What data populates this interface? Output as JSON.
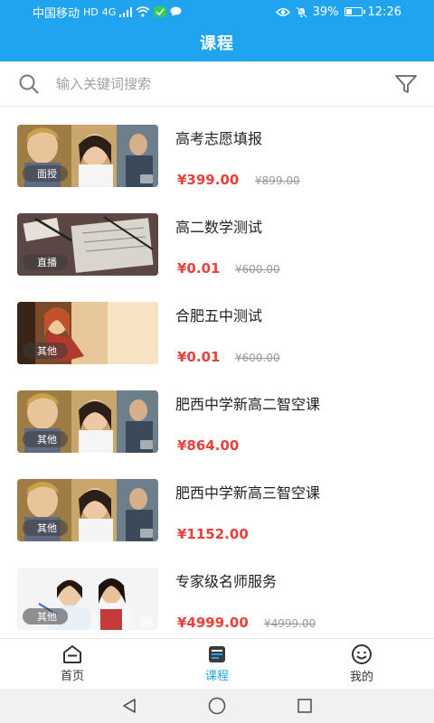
{
  "status_bar": {
    "carrier": "中国移动",
    "hd": "HD",
    "network": "4G",
    "battery": "39%",
    "battery_level": 0.39,
    "time": "12:26"
  },
  "header": {
    "title": "课程"
  },
  "search": {
    "placeholder": "输入关键词搜索"
  },
  "courses": [
    {
      "title": "高考志愿填报",
      "tag": "面授",
      "price": "¥399.00",
      "original_price": "¥899.00"
    },
    {
      "title": "高二数学测试",
      "tag": "直播",
      "price": "¥0.01",
      "original_price": "¥600.00"
    },
    {
      "title": "合肥五中测试",
      "tag": "其他",
      "price": "¥0.01",
      "original_price": "¥600.00"
    },
    {
      "title": "肥西中学新高二智空课",
      "tag": "其他",
      "price": "¥864.00",
      "original_price": ""
    },
    {
      "title": "肥西中学新高三智空课",
      "tag": "其他",
      "price": "¥1152.00",
      "original_price": ""
    },
    {
      "title": "专家级名师服务",
      "tag": "其他",
      "price": "¥4999.00",
      "original_price": "¥4999.00"
    }
  ],
  "tabs": [
    {
      "label": "首页",
      "icon": "home-icon",
      "active": false
    },
    {
      "label": "课程",
      "icon": "course-icon",
      "active": true
    },
    {
      "label": "我的",
      "icon": "profile-icon",
      "active": false
    }
  ],
  "colors": {
    "primary": "#21a4ef",
    "price": "#e8413a",
    "original_price": "#999999"
  }
}
